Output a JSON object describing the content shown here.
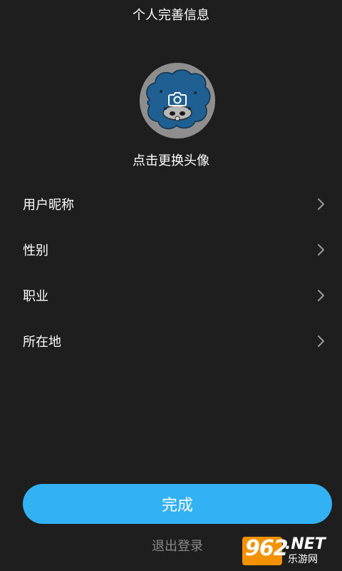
{
  "header": {
    "title": "个人完善信息"
  },
  "avatar": {
    "change_label": "点击更换头像",
    "camera_icon": "camera-icon"
  },
  "settings": {
    "items": [
      {
        "label": "用户昵称",
        "icon": "chevron-right-icon"
      },
      {
        "label": "性别",
        "icon": "chevron-right-icon"
      },
      {
        "label": "职业",
        "icon": "chevron-right-icon"
      },
      {
        "label": "所在地",
        "icon": "chevron-right-icon"
      }
    ]
  },
  "actions": {
    "done_label": "完成",
    "logout_label": "退出登录"
  },
  "watermark": {
    "number": "962",
    "net": ".NET",
    "site": "乐游网"
  },
  "colors": {
    "background": "#1e1e1e",
    "accent": "#33b1f5",
    "muted_text": "#8a8a8a",
    "watermark": "#f39200"
  }
}
